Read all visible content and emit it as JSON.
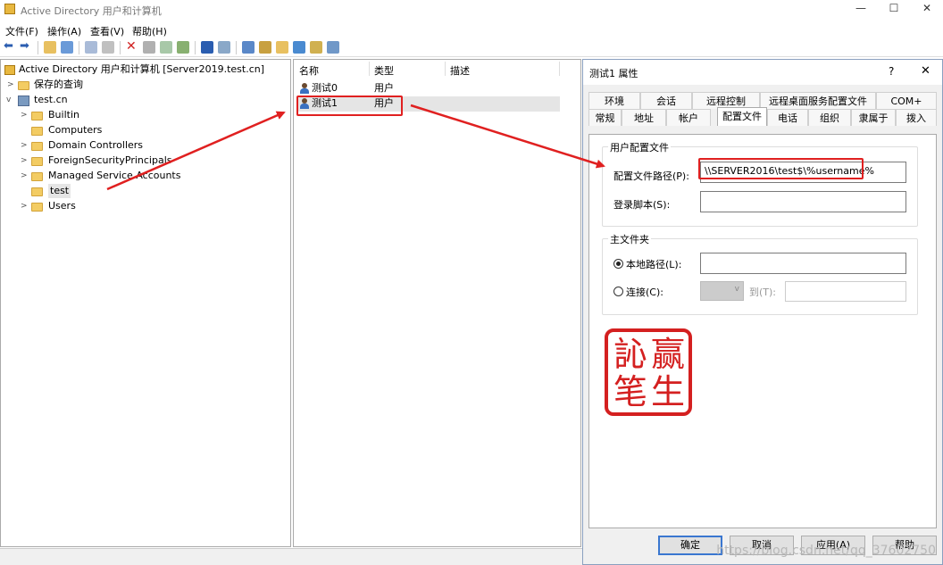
{
  "window": {
    "title": "Active Directory 用户和计算机",
    "minimize": "—",
    "maximize": "☐",
    "close": "✕"
  },
  "menu": [
    "文件(F)",
    "操作(A)",
    "查看(V)",
    "帮助(H)"
  ],
  "tree": {
    "root": "Active Directory 用户和计算机 [Server2019.test.cn]",
    "saved_queries": "保存的查询",
    "domain": "test.cn",
    "children": [
      "Builtin",
      "Computers",
      "Domain Controllers",
      "ForeignSecurityPrincipals",
      "Managed Service Accounts",
      "test",
      "Users"
    ]
  },
  "list": {
    "columns": [
      "名称",
      "类型",
      "描述"
    ],
    "rows": [
      {
        "name": "测试0",
        "type": "用户"
      },
      {
        "name": "测试1",
        "type": "用户"
      }
    ]
  },
  "dialog": {
    "title": "测试1 属性",
    "help": "?",
    "close": "✕",
    "tabs_row1": [
      "环境",
      "会话",
      "远程控制",
      "远程桌面服务配置文件",
      "COM+"
    ],
    "tabs_row2": [
      "常规",
      "地址",
      "帐户",
      "配置文件",
      "电话",
      "组织",
      "隶属于",
      "拨入"
    ],
    "profile_group": "用户配置文件",
    "profile_path_label": "配置文件路径(P):",
    "profile_path_value": "\\\\SERVER2016\\test$\\%username%",
    "logon_script_label": "登录脚本(S):",
    "logon_script_value": "",
    "home_group": "主文件夹",
    "local_path_label": "本地路径(L):",
    "connect_label": "连接(C):",
    "to_label": "到(T):",
    "buttons": {
      "ok": "确定",
      "cancel": "取消",
      "apply": "应用(A)",
      "help": "帮助"
    }
  },
  "seal": {
    "chars": [
      "笔",
      "赢",
      "訫",
      "生"
    ]
  },
  "watermark": "https://blog.csdn.net/qq_37602750",
  "colors": {
    "annotation_red": "#e02020",
    "seal_red": "#d42020",
    "folder": "#f3cc63"
  }
}
